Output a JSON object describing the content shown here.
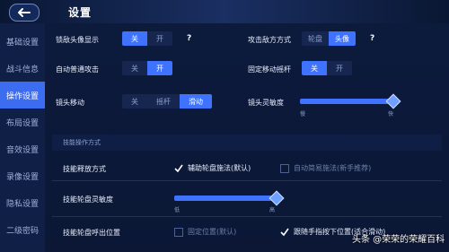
{
  "header": {
    "title": "设置",
    "back_icon": "back-arrow-icon"
  },
  "sidebar": {
    "items": [
      {
        "label": "基础设置",
        "active": false
      },
      {
        "label": "战斗信息",
        "active": false
      },
      {
        "label": "操作设置",
        "active": true
      },
      {
        "label": "布局设置",
        "active": false
      },
      {
        "label": "音效设置",
        "active": false
      },
      {
        "label": "录像设置",
        "active": false
      },
      {
        "label": "隐私设置",
        "active": false
      },
      {
        "label": "二级密码",
        "active": false
      }
    ]
  },
  "settings": {
    "lock_avatar": {
      "label": "锁敌头像显示",
      "options": [
        "关",
        "开"
      ],
      "selected": "关"
    },
    "attack_method": {
      "label": "攻击敌方方式",
      "options": [
        "轮盘",
        "头像"
      ],
      "selected": "头像"
    },
    "auto_attack": {
      "label": "自动普通攻击",
      "options": [
        "关",
        "开"
      ],
      "selected": "开"
    },
    "fixed_joystick": {
      "label": "固定移动摇杆",
      "options": [
        "关",
        "开"
      ],
      "selected": "关"
    },
    "camera_move": {
      "label": "镜头移动",
      "options": [
        "关",
        "摇杆",
        "滑动"
      ],
      "selected": "滑动"
    },
    "camera_sensitivity": {
      "label": "镜头灵敏度",
      "min_label": "慢",
      "max_label": "快",
      "value": 1.0
    },
    "help": "?"
  },
  "skill_section": {
    "title": "技能操作方式",
    "cast_mode": {
      "label": "技能释放方式",
      "option1": "辅助轮盘施法(默认)",
      "option1_checked": true,
      "option2": "自动简易施法(新手推荐)",
      "option2_checked": false
    },
    "wheel_sensitivity": {
      "label": "技能轮盘灵敏度",
      "min_label": "低",
      "max_label": "高",
      "value": 1.0
    },
    "wheel_position": {
      "label": "技能轮盘呼出位置",
      "option1": "固定位置(默认)",
      "option1_checked": false,
      "option2": "跟随手指按下位置(适合滑动)",
      "option2_checked": true
    }
  },
  "watermark": "头条 @荣荣的荣耀百科",
  "colors": {
    "accent": "#3f73ff",
    "background": "#0b1530",
    "sidebar": "#0f1f45"
  }
}
